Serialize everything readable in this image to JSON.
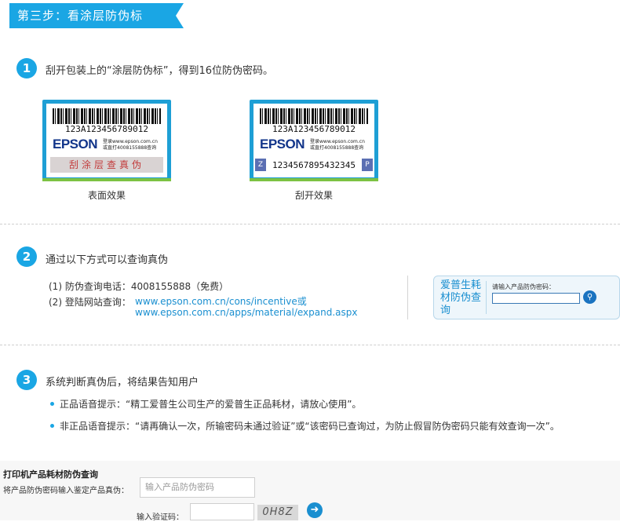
{
  "header": {
    "title": "第三步：看涂层防伪标"
  },
  "step1": {
    "number": "1",
    "text": "刮开包装上的“涂层防伪标”，得到16位防伪密码。",
    "label_code": "123A123456789012",
    "brand": "EPSON",
    "label_info_line1": "登录www.epson.com.cn",
    "label_info_line2": "或直打4008155888查询",
    "scratch_text": "刮涂层查真伪",
    "revealed_code": "1234567895432345",
    "left_caption": "表面效果",
    "right_caption": "刮开效果"
  },
  "step2": {
    "number": "2",
    "text": "通过以下方式可以查询真伪",
    "item1": "(1) 防伪查询电话：4008155888（免费）",
    "item2_prefix": "(2) 登陆网站查询：",
    "item2_link1": "www.epson.com.cn/cons/incentive或",
    "item2_link2": "www.epson.com.cn/apps/material/expand.aspx",
    "query_box": {
      "title": "爱普生耗材防伪查询",
      "input_label": "请输入产品防伪密码："
    }
  },
  "step3": {
    "number": "3",
    "text": "系统判断真伪后，将结果告知用户",
    "bullet1": "正品语音提示：“精工爱普生公司生产的爱普生正品耗材，请放心使用”。",
    "bullet2": "非正品语音提示：“请再确认一次，所输密码未通过验证”或“该密码已查询过，为防止假冒防伪密码只能有效查询一次”。"
  },
  "form": {
    "title": "打印机产品耗材防伪查询",
    "code_label": "将产品防伪密码输入鉴定产品真伪：",
    "code_placeholder": "输入产品防伪密码",
    "captcha_label": "输入验证码：",
    "captcha_text": "0H8Z"
  },
  "colors": {
    "accent": "#1aa6e4",
    "link": "#1a8fd0",
    "label_border": "#1e9fd5",
    "label_green": "#7dc243"
  }
}
